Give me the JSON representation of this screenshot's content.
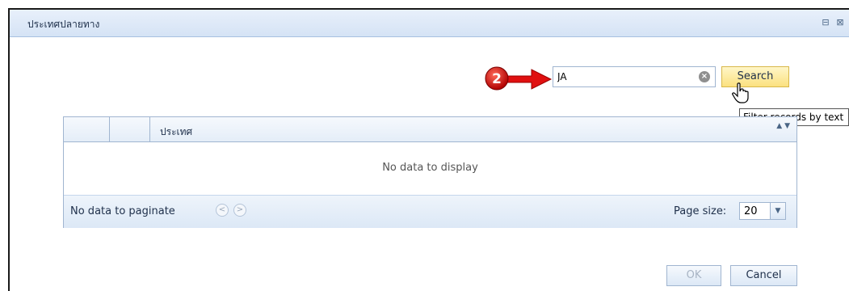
{
  "dialog": {
    "title": "ประเทศปลายทาง",
    "maximize_glyph": "⊟",
    "close_glyph": "⊠"
  },
  "annotation": {
    "number": "2"
  },
  "search": {
    "value": "JA",
    "clear_glyph": "×",
    "button_label": "Search",
    "tooltip": "Filter records by text"
  },
  "grid": {
    "column_header": "ประเทศ",
    "sort_glyph": "▲ ▼",
    "empty_text": "No data to display",
    "pager": {
      "text": "No data to paginate",
      "prev_glyph": "<",
      "next_glyph": ">",
      "page_size_label": "Page size:",
      "page_size_value": "20",
      "dropdown_glyph": "▼"
    }
  },
  "footer": {
    "ok_label": "OK",
    "cancel_label": "Cancel"
  },
  "colors": {
    "accent": "#d5e3f5",
    "border": "#a0b5d0",
    "highlight": "#fbe17f",
    "annotation_red": "#e01010"
  }
}
